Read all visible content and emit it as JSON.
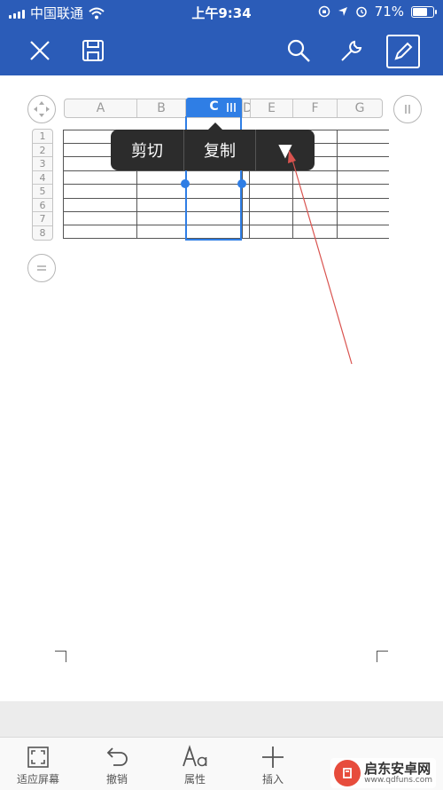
{
  "status_bar": {
    "carrier": "中国联通",
    "time": "上午9:34",
    "battery_percent": "71%",
    "battery_level": 0.71
  },
  "toolbar": {
    "icons": [
      "close-icon",
      "save-icon",
      "search-icon",
      "wrench-icon",
      "edit-pencil-icon"
    ]
  },
  "sheet": {
    "columns": [
      "A",
      "B",
      "C",
      "D",
      "E",
      "F",
      "G"
    ],
    "selected_column": "C",
    "rows": [
      "1",
      "2",
      "3",
      "4",
      "5",
      "6",
      "7",
      "8"
    ]
  },
  "context_menu": {
    "cut_label": "剪切",
    "copy_label": "复制",
    "more_glyph": "▼"
  },
  "bottom_bar": {
    "fit_screen": "适应屏幕",
    "undo": "撤销",
    "properties": "属性",
    "insert": "插入"
  },
  "watermark": {
    "name": "启东安卓网",
    "url": "www.qdfuns.com"
  },
  "colors": {
    "brand_blue": "#2b5cb8",
    "selection_blue": "#2f7ee5",
    "menu_bg": "#2c2c2c",
    "annotation_red": "#d9534f"
  }
}
